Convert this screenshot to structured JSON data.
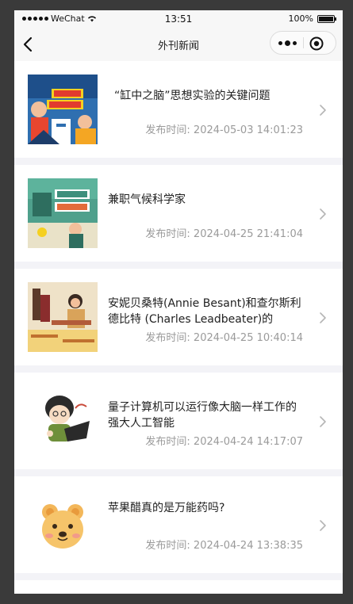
{
  "status_bar": {
    "carrier": "WeChat",
    "time": "13:51",
    "battery": "100%",
    "battery_level": 1.0
  },
  "nav": {
    "title": "外刊新闻"
  },
  "articles": [
    {
      "title": "“缸中之脑”思想实验的关键问题",
      "date_label": "发布时间:",
      "date": "2024-05-03 14:01:23"
    },
    {
      "title": "兼职气候科学家",
      "date_label": "发布时间:",
      "date": "2024-04-25 21:41:04"
    },
    {
      "title": "安妮贝桑特(Annie Besant)和查尔斯利德比特 (Charles Leadbeater)的",
      "date_label": "发布时间:",
      "date": "2024-04-25 10:40:14"
    },
    {
      "title": "量子计算机可以运行像大脑一样工作的强大人工智能",
      "date_label": "发布时间:",
      "date": "2024-04-24 14:17:07"
    },
    {
      "title": "苹果醋真的是万能药吗?",
      "date_label": "发布时间:",
      "date": "2024-04-24 13:38:35"
    }
  ],
  "icons": {
    "back": "back-arrow-icon",
    "more": "more-dots-icon",
    "close": "mini-program-close-icon",
    "chevron": "chevron-right-icon"
  }
}
